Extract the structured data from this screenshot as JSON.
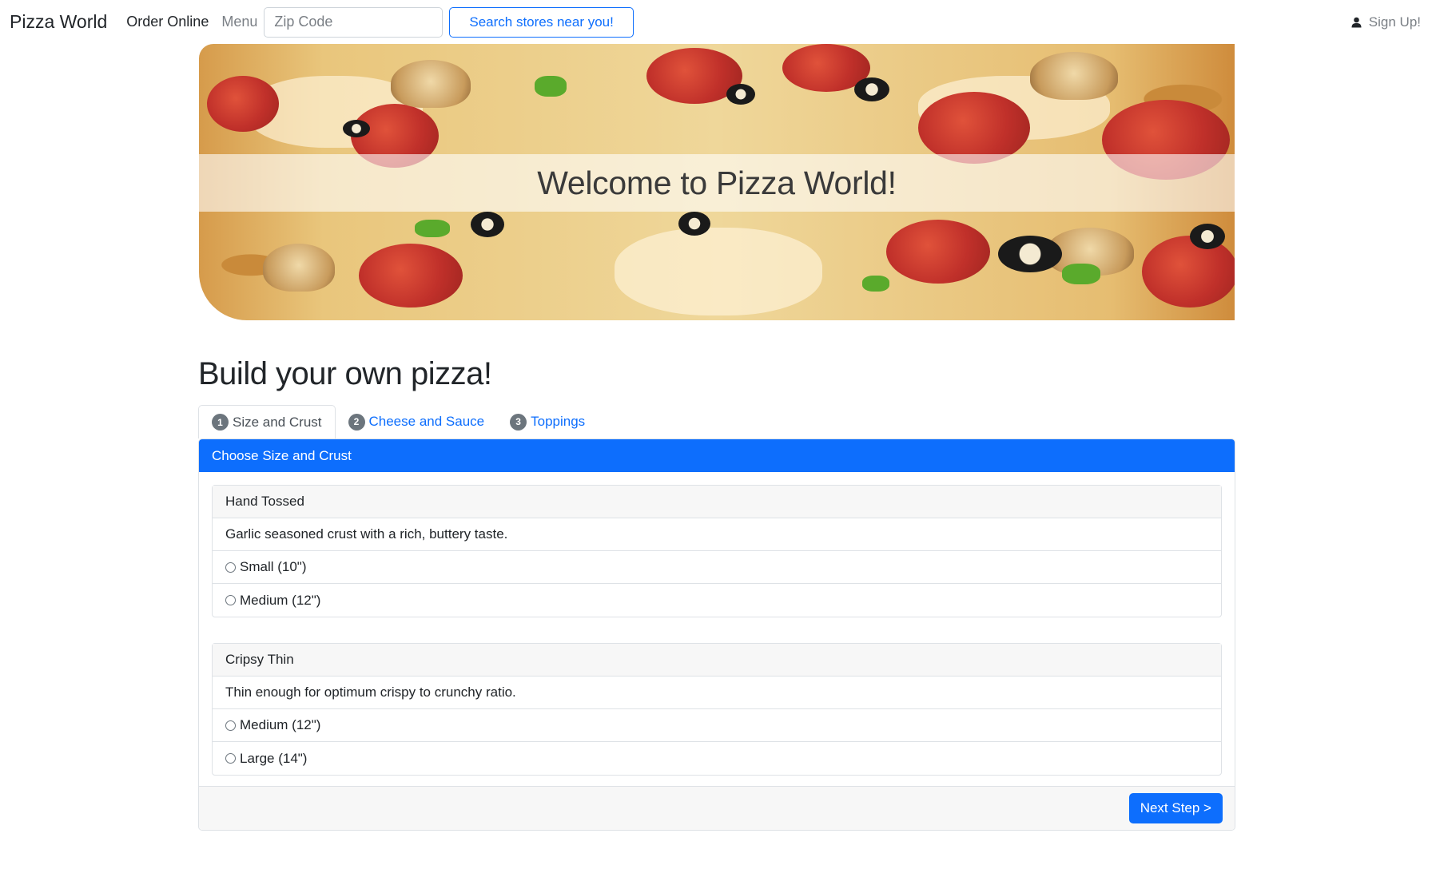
{
  "navbar": {
    "brand": "Pizza World",
    "links": [
      {
        "label": "Order Online"
      },
      {
        "label": "Menu"
      }
    ],
    "zip_placeholder": "Zip Code",
    "search_label": "Search stores near you!",
    "signup_label": "Sign Up!"
  },
  "hero": {
    "title": "Welcome to Pizza World!"
  },
  "builder": {
    "heading": "Build your own pizza!",
    "tabs": [
      {
        "number": "1",
        "label": "Size and Crust",
        "active": true
      },
      {
        "number": "2",
        "label": "Cheese and Sauce",
        "active": false
      },
      {
        "number": "3",
        "label": "Toppings",
        "active": false
      }
    ],
    "panel_title": "Choose Size and Crust",
    "crusts": [
      {
        "name": "Hand Tossed",
        "description": "Garlic seasoned crust with a rich, buttery taste.",
        "options": [
          "Small (10\")",
          "Medium (12\")"
        ]
      },
      {
        "name": "Cripsy Thin",
        "description": "Thin enough for optimum crispy to crunchy ratio.",
        "options": [
          "Medium (12\")",
          "Large (14\")"
        ]
      }
    ],
    "next_label": "Next Step >"
  },
  "colors": {
    "primary": "#0d6efd",
    "muted": "#6c757d",
    "text": "#212529"
  }
}
